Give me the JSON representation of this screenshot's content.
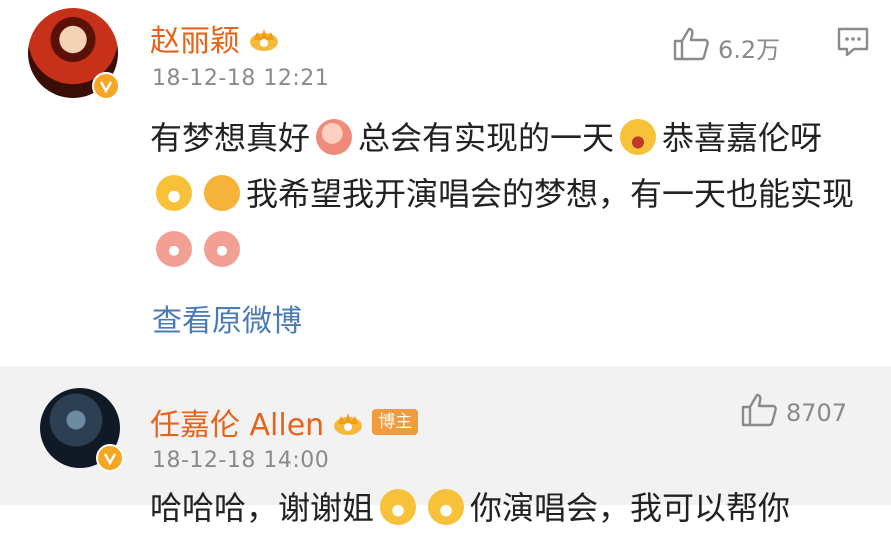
{
  "comments": [
    {
      "username": "赵丽颖",
      "time": "18-12-18 12:21",
      "likes": "6.2万",
      "text_parts": [
        "有梦想真好",
        "总会有实现的一天",
        "恭喜嘉伦呀",
        "我希望我开演唱会的梦想，有一天也能实现"
      ],
      "view_original": "查看原微博"
    },
    {
      "username": "任嘉伦 Allen",
      "badge": "博主",
      "time": "18-12-18 14:00",
      "likes": "8707",
      "text_parts": [
        "哈哈哈，谢谢姐",
        "你演唱会，我可以帮你"
      ]
    }
  ],
  "colors": {
    "username": "#e8631a",
    "link": "#4a7bb8",
    "meta": "#8a8a8a",
    "badge_bg": "#f19a3e",
    "second_comment_bg": "#f2f2f2"
  },
  "icons": [
    "crown-icon",
    "verified-icon",
    "thumbs-up-icon",
    "comment-icon"
  ]
}
